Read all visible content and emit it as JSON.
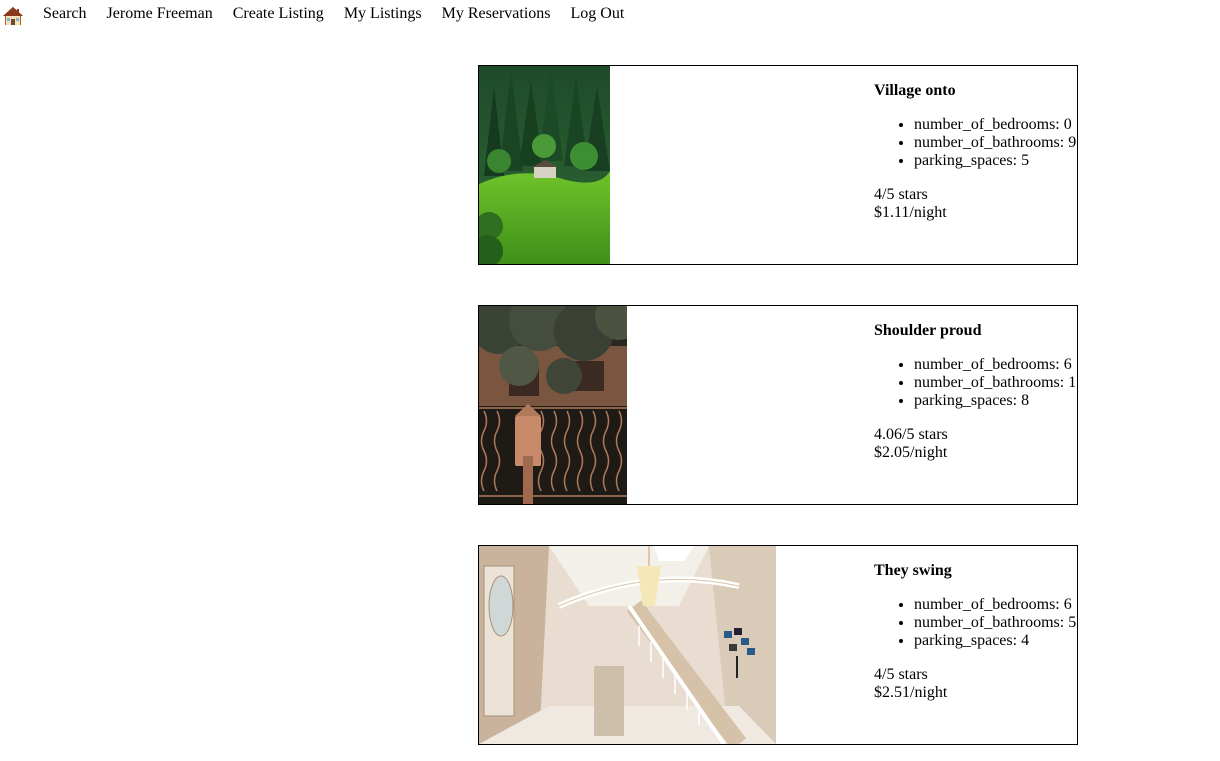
{
  "nav": {
    "home_icon": "house-icon",
    "links": [
      "Search",
      "Jerome Freeman",
      "Create Listing",
      "My Listings",
      "My Reservations",
      "Log Out"
    ]
  },
  "listings": [
    {
      "title": "Village onto",
      "features": [
        "number_of_bedrooms: 0",
        "number_of_bathrooms: 9",
        "parking_spaces: 5"
      ],
      "rating": "4/5 stars",
      "price": "$1.11/night",
      "photo": "forest-hillside-cabin"
    },
    {
      "title": "Shoulder proud",
      "features": [
        "number_of_bedrooms: 6",
        "number_of_bathrooms: 1",
        "parking_spaces: 8"
      ],
      "rating": "4.06/5 stars",
      "price": "$2.05/night",
      "photo": "gate-mailbox"
    },
    {
      "title": "They swing",
      "features": [
        "number_of_bedrooms: 6",
        "number_of_bathrooms: 5",
        "parking_spaces: 4"
      ],
      "rating": "4/5 stars",
      "price": "$2.51/night",
      "photo": "foyer-staircase"
    }
  ]
}
